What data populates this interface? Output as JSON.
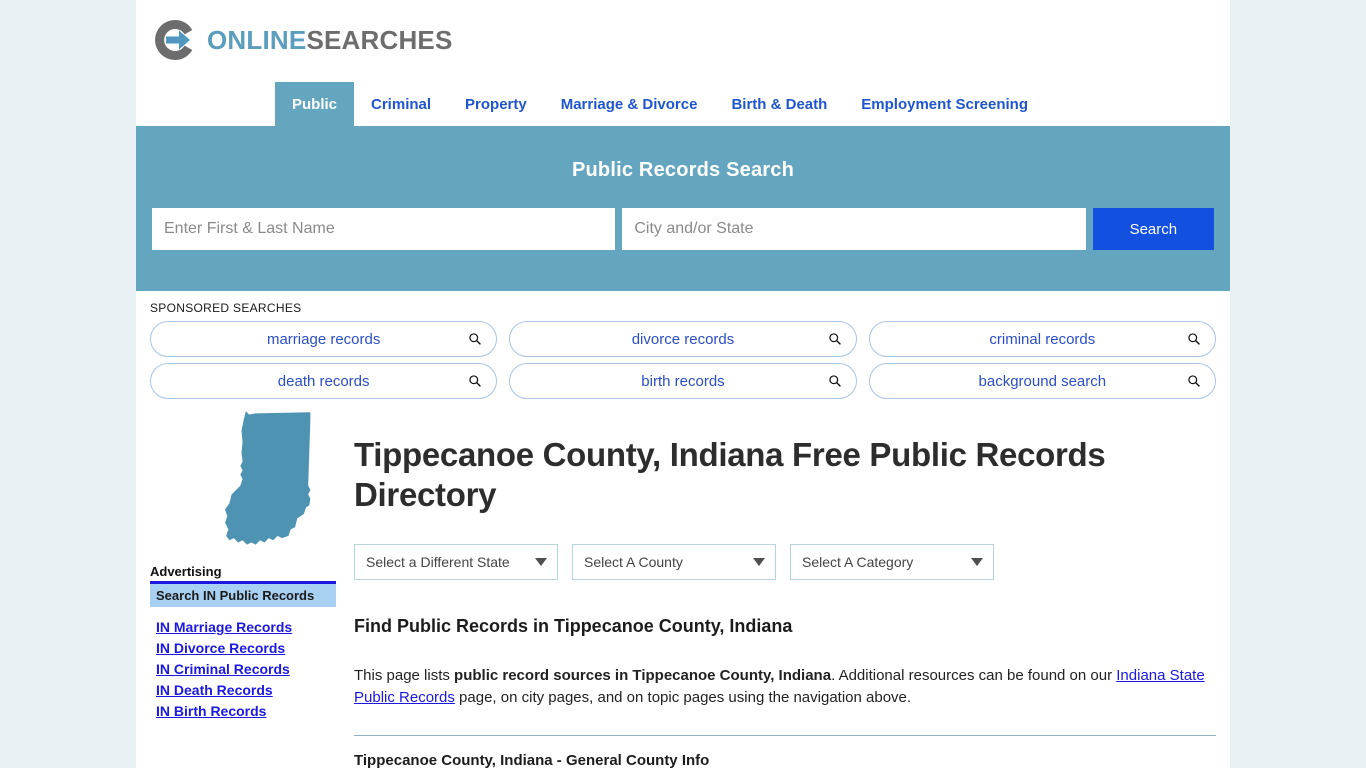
{
  "site": {
    "logo_primary": "ONLINE",
    "logo_secondary": "SEARCHES",
    "brand_blue": "#5b9dbd",
    "brand_gray": "#6d6d6d",
    "accent_teal": "#64a6bf",
    "link_blue": "#1b18e0",
    "button_blue": "#1450e0"
  },
  "nav": {
    "items": [
      {
        "label": "Public",
        "active": true
      },
      {
        "label": "Criminal",
        "active": false
      },
      {
        "label": "Property",
        "active": false
      },
      {
        "label": "Marriage & Divorce",
        "active": false
      },
      {
        "label": "Birth & Death",
        "active": false
      },
      {
        "label": "Employment Screening",
        "active": false
      }
    ]
  },
  "hero": {
    "title": "Public Records Search",
    "name_placeholder": "Enter First & Last Name",
    "name_value": "",
    "city_placeholder": "City and/or State",
    "city_value": "",
    "search_label": "Search"
  },
  "sponsored": {
    "label": "SPONSORED SEARCHES",
    "row1": [
      {
        "text": "marriage records",
        "icon": "search-icon"
      },
      {
        "text": "divorce records",
        "icon": "search-icon"
      },
      {
        "text": "criminal records",
        "icon": "search-icon"
      }
    ],
    "row2": [
      {
        "text": "death records",
        "icon": "search-icon"
      },
      {
        "text": "birth records",
        "icon": "search-icon"
      },
      {
        "text": "background search",
        "icon": "search-icon"
      }
    ]
  },
  "sidebar": {
    "state_map_name": "indiana-state-map",
    "advertising_label": "Advertising",
    "section_title": "Search IN Public Records",
    "links": [
      "IN Marriage Records",
      "IN Divorce Records",
      "IN Criminal Records",
      "IN Death Records",
      "IN Birth Records"
    ]
  },
  "main": {
    "page_title": "Tippecanoe County, Indiana Free Public Records Directory",
    "selects": [
      {
        "name": "state-select",
        "value": "Select a Different State"
      },
      {
        "name": "county-select",
        "value": "Select A County"
      },
      {
        "name": "category-select",
        "value": "Select A Category"
      }
    ],
    "sub_title": "Find Public Records in Tippecanoe County, Indiana",
    "paragraph": {
      "part1": "This page lists ",
      "bold1": "public record sources in Tippecanoe County, Indiana",
      "part2": ". Additional resources can be found on our ",
      "link1": "Indiana State Public Records",
      "part3": " page, on city pages, and on topic pages using the navigation above."
    },
    "section_heading": "Tippecanoe County, Indiana - General County Info"
  }
}
